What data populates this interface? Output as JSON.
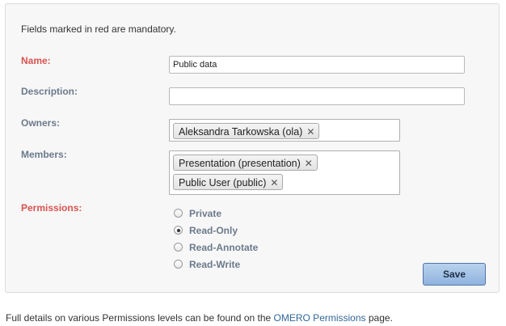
{
  "form": {
    "mandatory_note": "Fields marked in red are mandatory.",
    "name": {
      "label": "Name:",
      "value": "Public data",
      "required": true
    },
    "description": {
      "label": "Description:",
      "value": ""
    },
    "owners": {
      "label": "Owners:",
      "chips": [
        {
          "text": "Aleksandra Tarkowska (ola)"
        }
      ]
    },
    "members": {
      "label": "Members:",
      "chips": [
        {
          "text": "Presentation (presentation)"
        },
        {
          "text": "Public User (public)"
        }
      ]
    },
    "permissions": {
      "label": "Permissions:",
      "required": true,
      "options": [
        {
          "label": "Private",
          "selected": false
        },
        {
          "label": "Read-Only",
          "selected": true
        },
        {
          "label": "Read-Annotate",
          "selected": false
        },
        {
          "label": "Read-Write",
          "selected": false
        }
      ]
    },
    "save_label": "Save"
  },
  "footer": {
    "text_before": "Full details on various Permissions levels can be found on the ",
    "link_text": "OMERO Permissions",
    "text_after": " page."
  },
  "icons": {
    "chip_remove": "close-icon"
  },
  "colors": {
    "required_label": "#d9534f",
    "label": "#6b7a8c",
    "link": "#336699",
    "save_button": "#a3c2e6"
  }
}
